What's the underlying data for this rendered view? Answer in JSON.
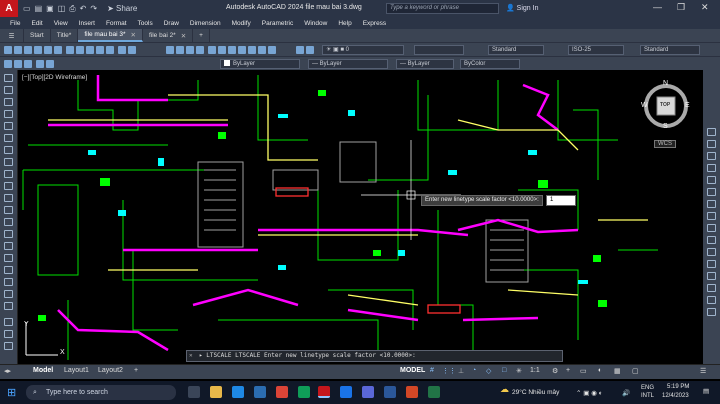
{
  "titlebar": {
    "app_letter": "A",
    "share_label": "Share",
    "title": "Autodesk AutoCAD 2024   file mau bai 3.dwg",
    "search_placeholder": "Type a keyword or phrase",
    "signin_label": "Sign In",
    "min_glyph": "—",
    "max_glyph": "❐",
    "close_glyph": "✕"
  },
  "menu": [
    "File",
    "Edit",
    "View",
    "Insert",
    "Format",
    "Tools",
    "Draw",
    "Dimension",
    "Modify",
    "Parametric",
    "Window",
    "Help",
    "Express"
  ],
  "tabs": [
    {
      "label": "Start",
      "active": false
    },
    {
      "label": "Title*",
      "active": false
    },
    {
      "label": "file mau bai 3*",
      "active": true
    },
    {
      "label": "file bai 2*",
      "active": false
    }
  ],
  "toolbar": {
    "text_style": "Standard",
    "dim_style": "ISO-25",
    "table_style": "Standard"
  },
  "properties": {
    "color": "ByLayer",
    "linetype": "ByLayer",
    "lineweight": "ByLayer",
    "plot_style": "ByColor"
  },
  "viewport": {
    "label": "[−][Top][2D Wireframe]",
    "viewcube": {
      "top": "TOP",
      "n": "N",
      "s": "S",
      "e": "E",
      "w": "W"
    },
    "wcs": "WCS",
    "ucs_x": "X",
    "ucs_y": "Y"
  },
  "dynamic_prompt": {
    "text": "Enter new linetype scale factor <10.0000>:",
    "value": "1"
  },
  "command_line": {
    "text": "▸ LTSCALE LTSCALE Enter new linetype scale factor <10.0000>:"
  },
  "layout_tabs": [
    {
      "label": "Model",
      "active": true
    },
    {
      "label": "Layout1",
      "active": false
    },
    {
      "label": "Layout2",
      "active": false
    }
  ],
  "status": {
    "model_label": "MODEL",
    "scale": "1:1"
  },
  "taskbar": {
    "search_placeholder": "Type here to search",
    "weather": "29°C  Nhiều mây",
    "lang_top": "ENG",
    "lang_bottom": "INTL",
    "time": "5:19 PM",
    "date": "12/4/2023"
  },
  "colors": {
    "accent_red": "#c4161c",
    "chrome": "#3b4453",
    "drawing_green": "#00ff00",
    "drawing_magenta": "#ff00ff",
    "drawing_yellow": "#ffff66",
    "drawing_cyan": "#00ffff",
    "drawing_gray": "#a0a0a0"
  }
}
